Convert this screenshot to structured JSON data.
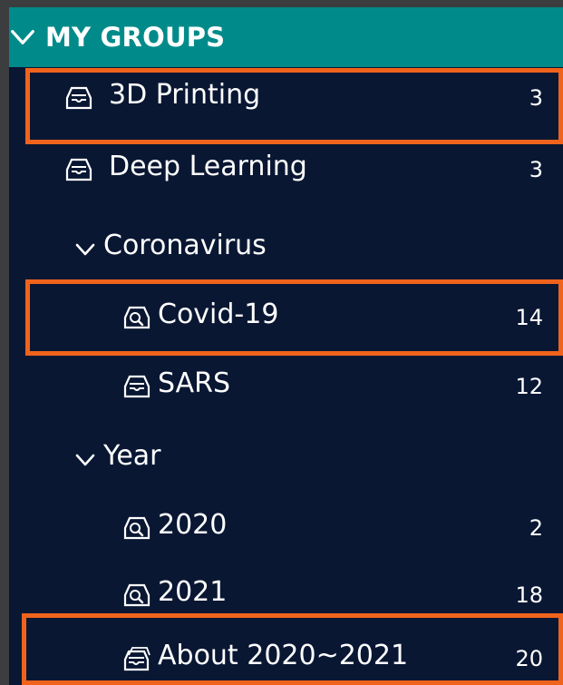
{
  "header": {
    "title": "MY GROUPS",
    "chevron_icon": "chevron-down-icon"
  },
  "items": [
    {
      "label": "3D Printing",
      "count": "3",
      "icon": "tray-icon"
    },
    {
      "label": "Deep Learning",
      "count": "3",
      "icon": "tray-icon"
    },
    {
      "label": "Coronavirus",
      "count": "",
      "icon": "chevron-down-icon"
    },
    {
      "label": "Covid-19",
      "count": "14",
      "icon": "search-tray-icon"
    },
    {
      "label": "SARS",
      "count": "12",
      "icon": "tray-icon"
    },
    {
      "label": "Year",
      "count": "",
      "icon": "chevron-down-icon"
    },
    {
      "label": "2020",
      "count": "2",
      "icon": "search-tray-icon"
    },
    {
      "label": "2021",
      "count": "18",
      "icon": "search-tray-icon"
    },
    {
      "label": "About 2020~2021",
      "count": "20",
      "icon": "stacked-tray-icon"
    }
  ],
  "colors": {
    "panel_bg": "#091733",
    "header_bg": "#008b8a",
    "highlight": "#f0631c",
    "text": "#ffffff"
  }
}
